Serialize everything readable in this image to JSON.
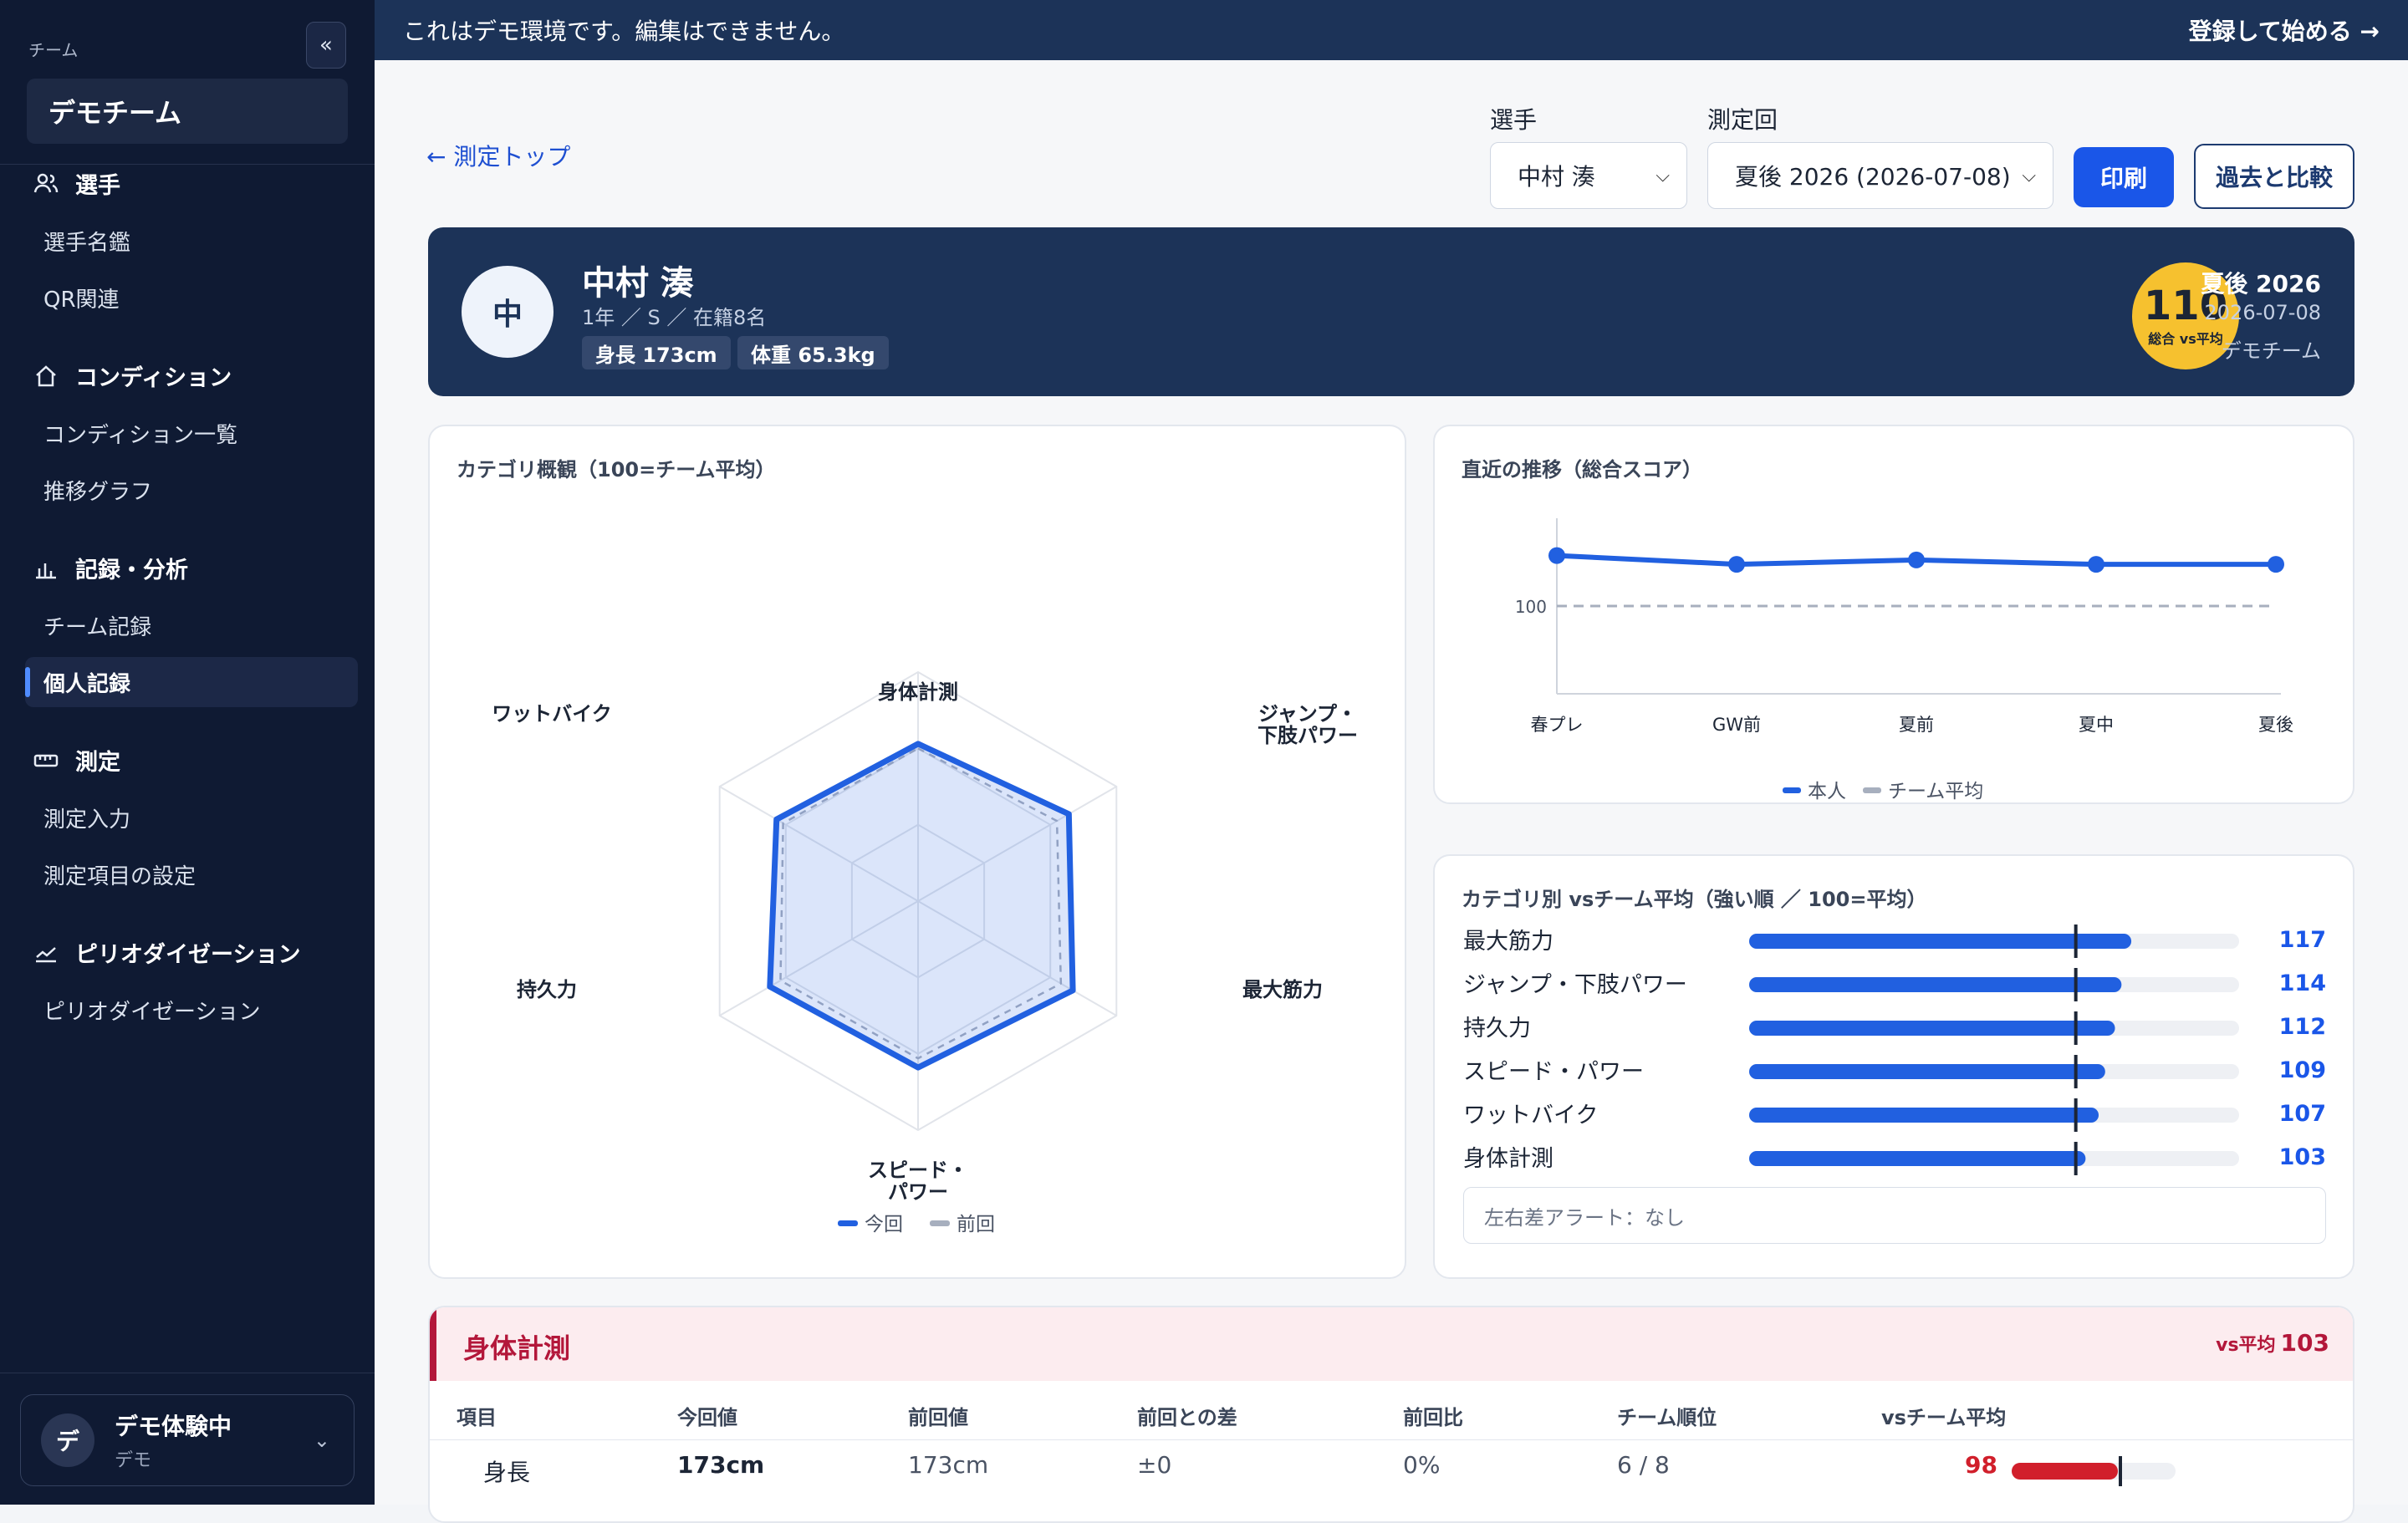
{
  "sidebar": {
    "team_label": "チーム",
    "collapse_label": "«",
    "team_name": "デモチーム",
    "sections": [
      {
        "label": "選手",
        "icon": "users-icon",
        "items": [
          "選手名鑑",
          "QR関連"
        ]
      },
      {
        "label": "コンディション",
        "icon": "home-icon",
        "items": [
          "コンディション一覧",
          "推移グラフ"
        ]
      },
      {
        "label": "記録・分析",
        "icon": "bar-chart-icon",
        "items": [
          "チーム記録",
          "個人記録"
        ]
      },
      {
        "label": "測定",
        "icon": "ruler-icon",
        "items": [
          "測定入力",
          "測定項目の設定"
        ]
      },
      {
        "label": "ピリオダイゼーション",
        "icon": "trend-icon",
        "items": [
          "ピリオダイゼーション"
        ]
      }
    ],
    "active_item": "個人記録",
    "user": {
      "avatar": "デ",
      "name": "デモ体験中",
      "sub": "デモ"
    }
  },
  "topbar": {
    "notice": "これはデモ環境です。編集はできません。",
    "cta": "登録して始める →"
  },
  "toolbar": {
    "back": "← 測定トップ",
    "player_label": "選手",
    "player_value": "中村 湊",
    "session_label": "測定回",
    "session_value": "夏後 2026 (2026-07-08)",
    "print": "印刷",
    "compare": "過去と比較"
  },
  "player": {
    "avatar": "中",
    "name": "中村 湊",
    "meta": "1年 ／ S ／ 在籍8名",
    "height": "身長 173cm",
    "weight": "体重 65.3kg",
    "score": "110",
    "score_caption": "総合 vs平均",
    "period": "夏後 2026",
    "date": "2026-07-08",
    "team": "デモチーム"
  },
  "radar": {
    "title": "カテゴリ概観（100=チーム平均）",
    "legend_current": "今回",
    "legend_previous": "前回"
  },
  "trend": {
    "title": "直近の推移（総合スコア）",
    "legend_self": "本人",
    "legend_avg": "チーム平均"
  },
  "category_bars": {
    "title": "カテゴリ別 vsチーム平均（強い順 ／ 100=平均）",
    "alert": "左右差アラート：なし"
  },
  "section": {
    "title": "身体計測",
    "vs_label": "vs平均",
    "vs_value": "103",
    "headers": [
      "項目",
      "今回値",
      "前回値",
      "前回との差",
      "前回比",
      "チーム順位",
      "vsチーム平均"
    ],
    "row": {
      "item": "身長",
      "current": "173cm",
      "previous": "173cm",
      "diff": "±0",
      "ratio": "0%",
      "rank": "6 / 8",
      "vs": "98",
      "vs_fraction": 0.98
    }
  },
  "colors": {
    "accent": "#1a56e8",
    "navy": "#1c3358",
    "sidebar": "#0f1a33",
    "gold": "#f6c12f",
    "red": "#d11f2b"
  },
  "chart_data": [
    {
      "type": "radar",
      "title": "カテゴリ概観（100=チーム平均）",
      "categories": [
        "身体計測",
        "ジャンプ・\n下肢パワー",
        "最大筋力",
        "スピード・\nパワー",
        "持久力",
        "ワットバイク"
      ],
      "series": [
        {
          "name": "今回",
          "values": [
            103,
            114,
            117,
            109,
            112,
            107
          ]
        },
        {
          "name": "前回",
          "values": [
            100,
            105,
            108,
            103,
            104,
            102
          ]
        }
      ],
      "range": [
        0,
        150
      ]
    },
    {
      "type": "line",
      "title": "直近の推移（総合スコア）",
      "x": [
        "春プレ",
        "GW前",
        "夏前",
        "夏中",
        "夏後"
      ],
      "series": [
        {
          "name": "本人",
          "values": [
            111.5,
            109.5,
            110.5,
            109.5,
            109.5
          ]
        },
        {
          "name": "チーム平均",
          "values": [
            100,
            100,
            100,
            100,
            100
          ]
        }
      ],
      "yticks": [
        100
      ],
      "ylim": [
        80,
        120
      ]
    },
    {
      "type": "bar",
      "title": "カテゴリ別 vsチーム平均（強い順 ／ 100=平均）",
      "categories": [
        "最大筋力",
        "ジャンプ・下肢パワー",
        "持久力",
        "スピード・パワー",
        "ワットバイク",
        "身体計測"
      ],
      "values": [
        117,
        114,
        112,
        109,
        107,
        103
      ],
      "reference": 100,
      "xlim": [
        0,
        150
      ]
    }
  ]
}
